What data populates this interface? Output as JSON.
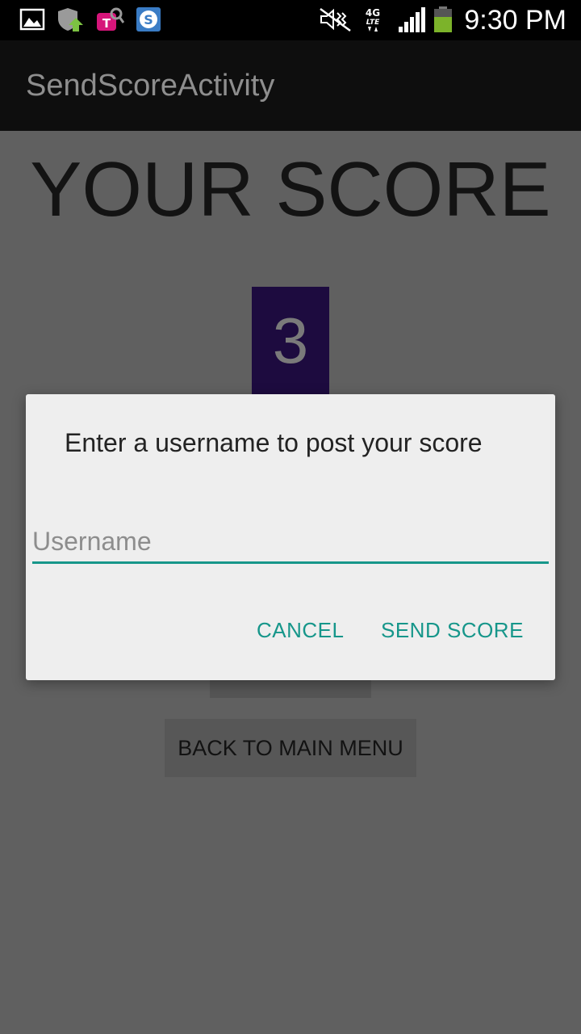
{
  "status_bar": {
    "time": "9:30 PM",
    "icons": [
      "gallery-icon",
      "shield-upload-icon",
      "tmobile-icon",
      "s-app-icon",
      "mute-icon",
      "4g-lte-icon",
      "signal-icon",
      "battery-icon"
    ],
    "battery_color": "#7cb32a"
  },
  "action_bar": {
    "title": "SendScoreActivity"
  },
  "content": {
    "heading": "YOUR SCORE",
    "score": "3",
    "score_box_color": "#1d0b3f",
    "back_button_label": "BACK TO MAIN MENU"
  },
  "dialog": {
    "message": "Enter a username to post your score",
    "username_placeholder": "Username",
    "username_value": "",
    "cancel_label": "CANCEL",
    "send_label": "SEND SCORE",
    "accent_color": "#16968a"
  }
}
